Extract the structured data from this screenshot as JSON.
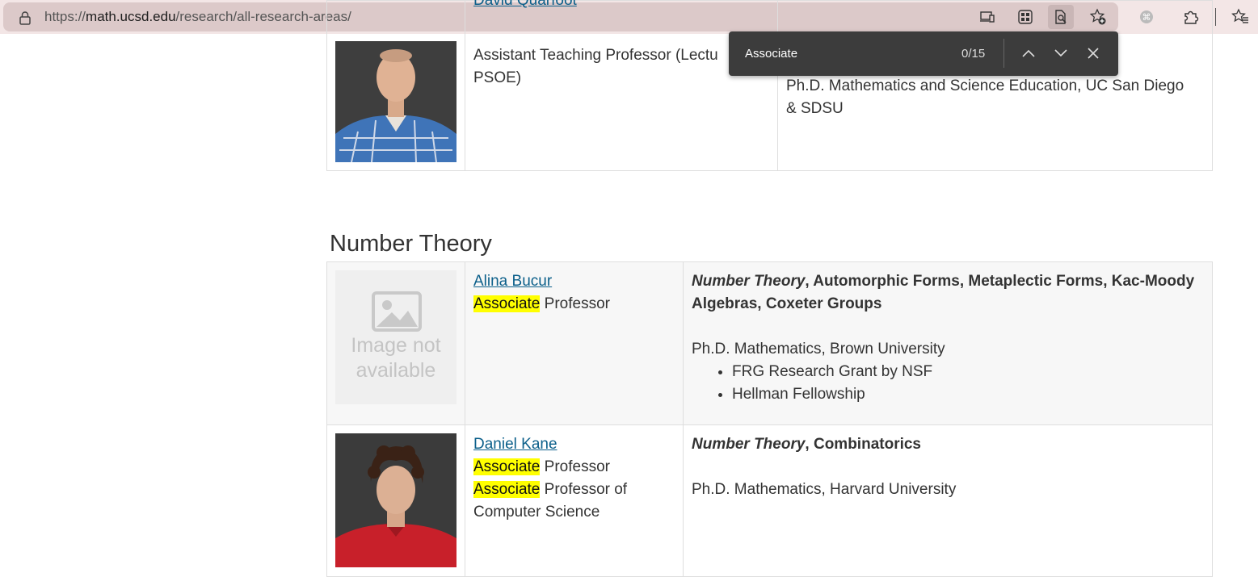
{
  "browser": {
    "url_prefix": "https://",
    "url_host": "math.ucsd.edu",
    "url_path": "/research/all-research-areas/",
    "icons": [
      "lock-icon",
      "device-icon",
      "apps-icon",
      "find-icon",
      "favorite-add-icon",
      "extension-icon",
      "puzzle-icon",
      "favorites-icon"
    ]
  },
  "findbar": {
    "query": "Associate",
    "count": "0/15"
  },
  "top_entry": {
    "name": "David Quarfoot",
    "title_line1": "Assistant Teaching Professor (Lectu",
    "title_line2": "PSOE)",
    "edu_line1": "Ph.D. Mathematics and Science Education, UC San Diego",
    "edu_line2": "& SDSU"
  },
  "section": {
    "title": "Number Theory"
  },
  "faculty": [
    {
      "name": "Alina Bucur",
      "photo_alt_line1": "Image not",
      "photo_alt_line2": "available",
      "title_hl": "Associate",
      "title_rest": " Professor",
      "area_italic": "Number Theory",
      "area_rest": ", Automorphic Forms, Metaplectic Forms, Kac-Moody Algebras, Coxeter Groups",
      "degree": "Ph.D. Mathematics, Brown University",
      "awards": [
        "FRG Research Grant by NSF",
        "Hellman Fellowship"
      ]
    },
    {
      "name": "Daniel Kane",
      "title1_hl": "Associate",
      "title1_rest": " Professor",
      "title2_hl": "Associate",
      "title2_rest": " Professor of",
      "title2_line2": "Computer Science",
      "area_italic": "Number Theory",
      "area_rest": ", Combinatorics",
      "degree": "Ph.D. Mathematics, Harvard University"
    }
  ],
  "colors": {
    "link": "#0b5f8a",
    "highlight": "#ffff00",
    "findbar_bg": "#3c3c3c",
    "toolbar_bg": "#f3e6e6"
  }
}
